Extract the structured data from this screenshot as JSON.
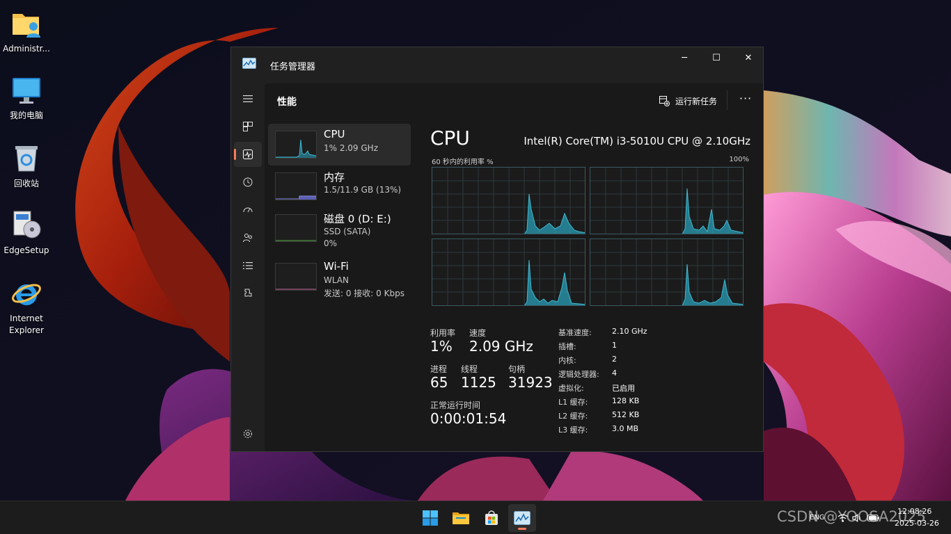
{
  "desktop": {
    "icons": [
      {
        "label": "Administr...",
        "icon": "folder-user-icon"
      },
      {
        "label": "我的电脑",
        "icon": "monitor-icon"
      },
      {
        "label": "回收站",
        "icon": "recycle-bin-icon"
      },
      {
        "label": "EdgeSetup",
        "icon": "installer-icon"
      },
      {
        "label": "Internet\nExplorer",
        "icon": "internet-explorer-icon"
      }
    ]
  },
  "window": {
    "title": "任务管理器",
    "controls": {
      "minimize": "─",
      "maximize": "☐",
      "close": "✕"
    }
  },
  "nav": {
    "items": [
      {
        "name": "hamburger-menu-icon"
      },
      {
        "name": "processes-icon"
      },
      {
        "name": "performance-icon",
        "active": true
      },
      {
        "name": "app-history-icon"
      },
      {
        "name": "startup-apps-icon"
      },
      {
        "name": "users-icon"
      },
      {
        "name": "details-icon"
      },
      {
        "name": "services-icon"
      },
      {
        "name": "settings-icon"
      }
    ]
  },
  "header": {
    "title": "性能",
    "run_new_task": "运行新任务",
    "more": "···"
  },
  "devices": [
    {
      "name": "CPU",
      "sub1": "1% 2.09 GHz",
      "sub2": "",
      "selected": true
    },
    {
      "name": "内存",
      "sub1": "1.5/11.9 GB (13%)",
      "sub2": "",
      "selected": false
    },
    {
      "name": "磁盘 0 (D: E:)",
      "sub1": "SSD (SATA)",
      "sub2": "0%",
      "selected": false
    },
    {
      "name": "Wi-Fi",
      "sub1": "WLAN",
      "sub2": "发送: 0 接收: 0 Kbps",
      "selected": false
    }
  ],
  "detail": {
    "title": "CPU",
    "model": "Intel(R) Core(TM) i3-5010U CPU @ 2.10GHz",
    "graph_label": "60 秒内的利用率 %",
    "graph_max": "100%",
    "stats": {
      "utilization_label": "利用率",
      "utilization": "1%",
      "speed_label": "速度",
      "speed": "2.09 GHz",
      "processes_label": "进程",
      "processes": "65",
      "threads_label": "线程",
      "threads": "1125",
      "handles_label": "句柄",
      "handles": "31923",
      "uptime_label": "正常运行时间",
      "uptime": "0:00:01:54"
    },
    "specs": [
      {
        "key": "基准速度:",
        "value": "2.10 GHz"
      },
      {
        "key": "插槽:",
        "value": "1"
      },
      {
        "key": "内核:",
        "value": "2"
      },
      {
        "key": "逻辑处理器:",
        "value": "4"
      },
      {
        "key": "虚拟化:",
        "value": "已启用"
      },
      {
        "key": "L1 缓存:",
        "value": "128 KB"
      },
      {
        "key": "L2 缓存:",
        "value": "512 KB"
      },
      {
        "key": "L3 缓存:",
        "value": "3.0 MB"
      }
    ]
  },
  "taskbar": {
    "apps": [
      {
        "name": "start-button-icon"
      },
      {
        "name": "file-explorer-icon"
      },
      {
        "name": "microsoft-store-icon"
      },
      {
        "name": "task-manager-icon",
        "active": true
      }
    ],
    "lang": "ENG",
    "time": "12:08:26",
    "date": "2025-03-26"
  },
  "watermark": "CSDN @YOOSA2025",
  "colors": {
    "accent": "#ff7b5c",
    "graph_fill": "#2a9db6",
    "graph_line": "#3fb9d3"
  }
}
